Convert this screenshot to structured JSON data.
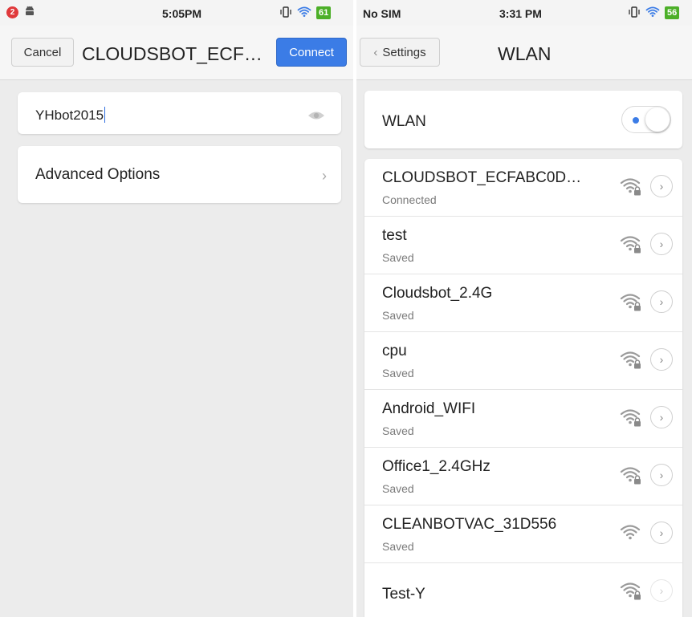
{
  "colors": {
    "accent": "#3b7ce6",
    "battery": "#4caf28",
    "notification": "#e0393b"
  },
  "left": {
    "status": {
      "notification_count": "2",
      "time": "5:05PM",
      "battery": "61"
    },
    "nav": {
      "cancel_label": "Cancel",
      "title": "CLOUDSBOT_ECF…",
      "connect_label": "Connect"
    },
    "password": {
      "value": "YHbot2015",
      "visibility_icon": "eye-icon"
    },
    "advanced": {
      "label": "Advanced Options",
      "icon": "chevron-right-icon"
    }
  },
  "right": {
    "status": {
      "carrier": "No SIM",
      "time": "3:31 PM",
      "battery": "56"
    },
    "nav": {
      "back_label": "Settings",
      "title": "WLAN"
    },
    "wlan": {
      "label": "WLAN",
      "enabled": true
    },
    "networks": [
      {
        "ssid": "CLOUDSBOT_ECFABC0D…",
        "status": "Connected",
        "secured": true
      },
      {
        "ssid": "test",
        "status": "Saved",
        "secured": true
      },
      {
        "ssid": "Cloudsbot_2.4G",
        "status": "Saved",
        "secured": true
      },
      {
        "ssid": "cpu",
        "status": "Saved",
        "secured": true
      },
      {
        "ssid": "Android_WIFI",
        "status": "Saved",
        "secured": true
      },
      {
        "ssid": "Office1_2.4GHz",
        "status": "Saved",
        "secured": true
      },
      {
        "ssid": "CLEANBOTVAC_31D556",
        "status": "Saved",
        "secured": false
      },
      {
        "ssid": "Test-Y",
        "status": "",
        "secured": true
      }
    ]
  }
}
